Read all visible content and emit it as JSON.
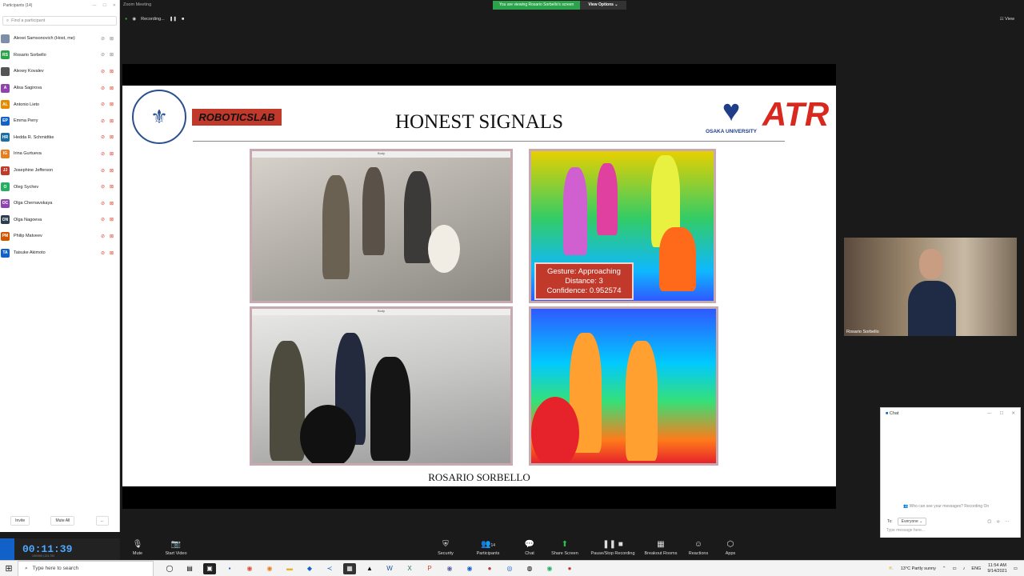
{
  "participants_panel": {
    "title": "Participants (14)",
    "search_placeholder": "Find a participant",
    "items": [
      {
        "initials": "",
        "name": "Alexei Samsonovich (Host, me)",
        "color": "#7d8fa8"
      },
      {
        "initials": "RS",
        "name": "Rosario Sorbello",
        "color": "#2aa34a"
      },
      {
        "initials": "",
        "name": "Alexey Kovalev",
        "color": "#555555"
      },
      {
        "initials": "A",
        "name": "Alisa Sagirova",
        "color": "#8e44ad"
      },
      {
        "initials": "AL",
        "name": "Antonio Lieto",
        "color": "#e68a00"
      },
      {
        "initials": "EP",
        "name": "Emma Perry",
        "color": "#1261c9"
      },
      {
        "initials": "HR",
        "name": "Hedda R. Schmidtke",
        "color": "#1d6fa3"
      },
      {
        "initials": "IG",
        "name": "Irina Gurtueva",
        "color": "#e67e22"
      },
      {
        "initials": "JJ",
        "name": "Josephine Jefferson",
        "color": "#c0392b"
      },
      {
        "initials": "O",
        "name": "Oleg Sychev",
        "color": "#27ae60"
      },
      {
        "initials": "OC",
        "name": "Olga Chernavskaya",
        "color": "#8e44ad"
      },
      {
        "initials": "ON",
        "name": "Olga Nagoeva",
        "color": "#2c3e50"
      },
      {
        "initials": "PM",
        "name": "Philip Matveev",
        "color": "#d35400"
      },
      {
        "initials": "TA",
        "name": "Taisuke Akimoto",
        "color": "#1261c9"
      }
    ],
    "invite_label": "Invite",
    "mute_all_label": "Mute All",
    "more_label": "..."
  },
  "meeting": {
    "window_title": "Zoom Meeting",
    "viewing_banner": "You are viewing Rosario Sorbello's screen",
    "view_options_label": "View Options ⌄",
    "recording_label": "Recording...",
    "view_label": "View"
  },
  "slide": {
    "title": "HONEST SIGNALS",
    "robotics_label": "ROBOTICSLAB",
    "osaka_label": "OSAKA UNIVERSITY",
    "atr_label": "ATR",
    "panel_title_1": "Body",
    "panel_title_2": "Body",
    "gesture_line1": "Gesture: Approaching",
    "gesture_line2": "Distance: 3",
    "gesture_line3": "Confidence: 0.952574",
    "presenter_caption": "ROSARIO SORBELLO"
  },
  "video_tile": {
    "name": "Rosario Sorbello"
  },
  "chat": {
    "title": "Chat",
    "who_can_see": "Who can see your messages? Recording On",
    "to_label": "To:",
    "to_value": "Everyone ⌄",
    "input_placeholder": "Type message here..."
  },
  "timer": {
    "value": "00:11:39",
    "sub": "100/390 | 221,700"
  },
  "toolbar": {
    "mute": "Mute",
    "start_video": "Start Video",
    "security": "Security",
    "participants": "Participants",
    "participants_count": "14",
    "chat": "Chat",
    "share_screen": "Share Screen",
    "pause_recording": "Pause/Stop Recording",
    "breakout_rooms": "Breakout Rooms",
    "reactions": "Reactions",
    "apps": "Apps"
  },
  "taskbar": {
    "search_placeholder": "Type here to search",
    "weather": "13°C  Partly sunny",
    "lang": "ENG",
    "time": "11:54 AM",
    "date": "9/14/2021"
  },
  "colors": {
    "zoom_green": "#2aa34a",
    "zoom_blue": "#1261c9",
    "mute_red": "#d9432b"
  }
}
